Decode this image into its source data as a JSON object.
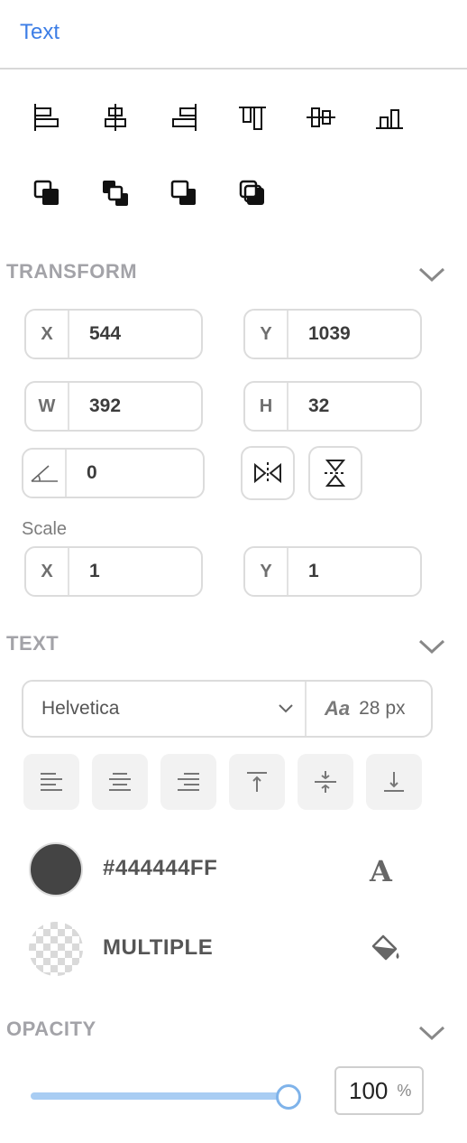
{
  "header": {
    "tab_label": "Text"
  },
  "arrange": {
    "align_icons": [
      "align-left-icon",
      "align-horizontal-center-icon",
      "align-right-icon",
      "align-top-icon",
      "align-vertical-center-icon",
      "align-bottom-icon"
    ],
    "layer_icons": [
      "bring-forward-icon",
      "bring-to-front-icon",
      "send-backward-icon",
      "send-to-back-icon"
    ]
  },
  "transform": {
    "title": "TRANSFORM",
    "x": {
      "label": "X",
      "value": "544"
    },
    "y": {
      "label": "Y",
      "value": "1039"
    },
    "w": {
      "label": "W",
      "value": "392"
    },
    "h": {
      "label": "H",
      "value": "32"
    },
    "rotation": {
      "value": "0"
    },
    "scale": {
      "label": "Scale",
      "x": {
        "label": "X",
        "value": "1"
      },
      "y": {
        "label": "Y",
        "value": "1"
      }
    }
  },
  "text": {
    "title": "TEXT",
    "font_family": "Helvetica",
    "font_size_icon": "Aa",
    "font_size": "28 px",
    "alignment_icons": [
      "text-align-left-icon",
      "text-align-center-icon",
      "text-align-right-icon",
      "vertical-align-top-icon",
      "vertical-align-middle-icon",
      "vertical-align-bottom-icon"
    ],
    "text_color": {
      "hex": "#444444FF",
      "swatch": "#444444",
      "icon": "A"
    },
    "fill_color": {
      "label": "MULTIPLE"
    }
  },
  "opacity": {
    "title": "OPACITY",
    "value": "100",
    "unit": "%",
    "level": 1.0
  },
  "colors": {
    "accent": "#3d7ee6",
    "slider": "#a9cdf3"
  }
}
